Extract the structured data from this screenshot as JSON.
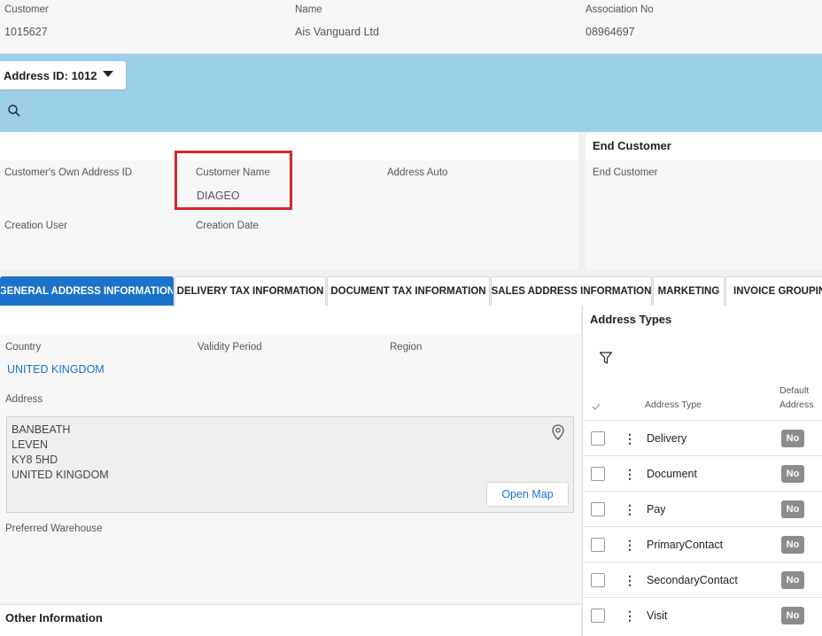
{
  "header": {
    "customer_label": "Customer",
    "customer_value": "1015627",
    "name_label": "Name",
    "name_value": "Ais Vanguard Ltd",
    "association_label": "Association No",
    "association_value": "08964697"
  },
  "address_selector": {
    "label": "Address ID: 1012"
  },
  "icons": {
    "search": "search-icon",
    "caret": "caret-down-icon",
    "pin": "map-pin-icon",
    "filter": "filter-icon",
    "kebab": "kebab-icon",
    "check": "check-icon"
  },
  "info_card": {
    "own_address_id_label": "Customer's Own Address ID",
    "customer_name_label": "Customer Name",
    "customer_name_value": "DIAGEO",
    "address_auto_label": "Address Auto",
    "creation_user_label": "Creation User",
    "creation_date_label": "Creation Date",
    "highlight_color": "#d9242b"
  },
  "end_customer_card": {
    "title": "End Customer",
    "end_customer_label": "End Customer"
  },
  "tabs": [
    {
      "label": "GENERAL ADDRESS INFORMATION",
      "active": true
    },
    {
      "label": "DELIVERY TAX INFORMATION"
    },
    {
      "label": "DOCUMENT TAX INFORMATION"
    },
    {
      "label": "SALES ADDRESS INFORMATION"
    },
    {
      "label": "MARKETING"
    },
    {
      "label": "INVOICE GROUPING"
    }
  ],
  "general": {
    "country_label": "Country",
    "country_value": "UNITED KINGDOM",
    "validity_label": "Validity Period",
    "region_label": "Region",
    "address_label": "Address",
    "address_lines": [
      "BANBEATH",
      "LEVEN",
      "KY8 5HD",
      "UNITED KINGDOM"
    ],
    "open_map_label": "Open Map",
    "preferred_warehouse_label": "Preferred Warehouse",
    "other_info_title": "Other Information"
  },
  "address_types": {
    "title": "Address Types",
    "col_address_type": "Address Type",
    "col_default_1": "Default",
    "col_default_2": "Address",
    "rows": [
      {
        "type": "Delivery",
        "default": "No"
      },
      {
        "type": "Document",
        "default": "No"
      },
      {
        "type": "Pay",
        "default": "No"
      },
      {
        "type": "PrimaryContact",
        "default": "No"
      },
      {
        "type": "SecondaryContact",
        "default": "No"
      },
      {
        "type": "Visit",
        "default": "No"
      }
    ]
  },
  "colors": {
    "accent": "#1a73c8",
    "band": "#9ccfe9",
    "badge": "#8c8c8c"
  }
}
